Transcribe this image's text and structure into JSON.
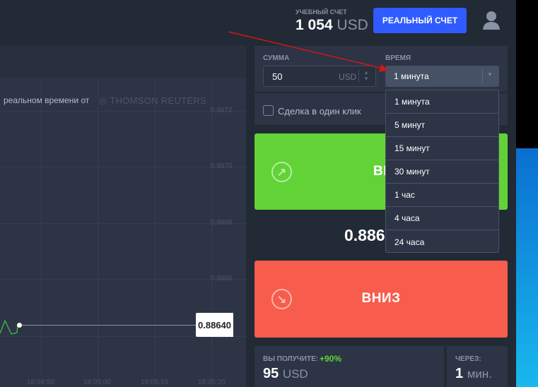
{
  "header": {
    "account_label": "УЧЕБНЫЙ СЧЕТ",
    "balance": "1 054",
    "currency": "USD",
    "real_account_button": "РЕАЛЬНЫЙ СЧЕТ"
  },
  "chart": {
    "provider_text": "реальном времени от",
    "provider_brand": "THOMSON REUTERS",
    "y_ticks": [
      "0.8872",
      "0.8870",
      "0.8868",
      "0.8866",
      "0.8864"
    ],
    "x_ticks": [
      "18:04:50",
      "18:05:00",
      "18:05:10",
      "18:05:20"
    ],
    "current_price": "0.88640",
    "line_color": "#3cbf4a"
  },
  "form": {
    "amount_label": "СУММА",
    "amount_value": "50",
    "amount_currency": "USD",
    "time_label": "ВРЕМЯ",
    "time_value": "1 минута",
    "one_click_label": "Сделка в один клик",
    "one_click_checked": false
  },
  "dropdown": {
    "options": [
      "1 минута",
      "5 минут",
      "15 минут",
      "30 минут",
      "1 час",
      "4 часа",
      "24 часа"
    ]
  },
  "trade": {
    "up_label": "ВВЕРХ",
    "up_visible": "ВВ",
    "price": "0.886",
    "down_label": "ВНИЗ",
    "up_color": "#62d336",
    "down_color": "#f75c4c"
  },
  "result": {
    "receive_label": "ВЫ ПОЛУЧИТЕ:",
    "percent": "+90%",
    "amount": "95",
    "currency": "USD",
    "after_label": "ЧЕРЕЗ:",
    "after_value": "1",
    "after_unit": "мин."
  }
}
